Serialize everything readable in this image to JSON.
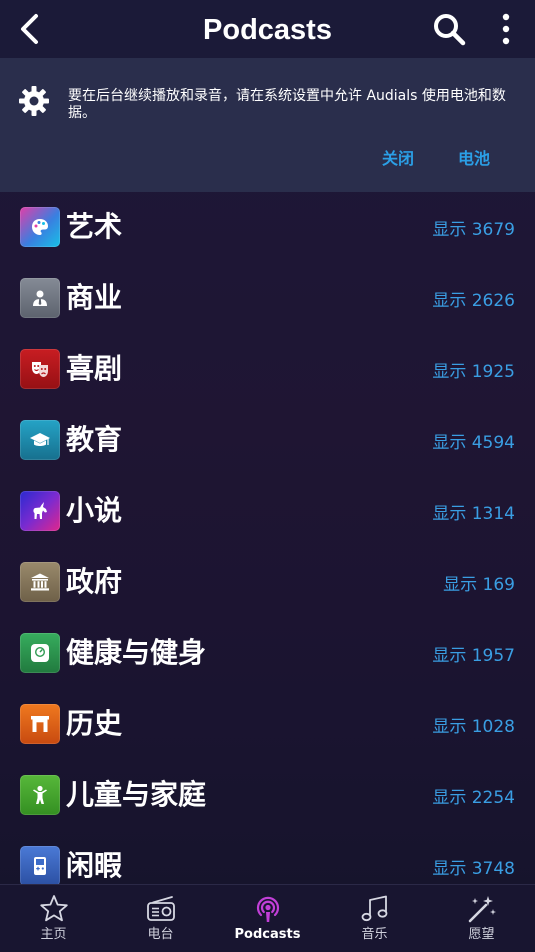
{
  "header": {
    "title": "Podcasts"
  },
  "banner": {
    "message": "要在后台继续播放和录音，请在系统设置中允许 Audials 使用电池和数据。",
    "close_label": "关闭",
    "battery_label": "电池"
  },
  "categories": [
    {
      "label": "艺术",
      "count": "显示 3679",
      "icon": "palette-icon",
      "color": "#3a7fe0"
    },
    {
      "label": "商业",
      "count": "显示 2626",
      "icon": "businessman-icon",
      "color": "#6e7480"
    },
    {
      "label": "喜剧",
      "count": "显示 1925",
      "icon": "theater-masks-icon",
      "color": "#b5161b"
    },
    {
      "label": "教育",
      "count": "显示 4594",
      "icon": "graduation-cap-icon",
      "color": "#1f8fb0"
    },
    {
      "label": "小说",
      "count": "显示 1314",
      "icon": "unicorn-icon",
      "color": "#6a2cc9"
    },
    {
      "label": "政府",
      "count": "显示 169",
      "icon": "government-building-icon",
      "color": "#8a7a5e"
    },
    {
      "label": "健康与健身",
      "count": "显示 1957",
      "icon": "scale-icon",
      "color": "#2f9a52"
    },
    {
      "label": "历史",
      "count": "显示 1028",
      "icon": "arch-icon",
      "color": "#e0641a"
    },
    {
      "label": "儿童与家庭",
      "count": "显示 2254",
      "icon": "child-icon",
      "color": "#4aa82e"
    },
    {
      "label": "闲暇",
      "count": "显示 3748",
      "icon": "gameboy-icon",
      "color": "#3b6bc8"
    }
  ],
  "nav": [
    {
      "label": "主页",
      "icon": "star-icon"
    },
    {
      "label": "电台",
      "icon": "radio-icon"
    },
    {
      "label": "Podcasts",
      "icon": "podcast-icon",
      "active": true,
      "color": "#c23fd8"
    },
    {
      "label": "音乐",
      "icon": "music-note-icon"
    },
    {
      "label": "愿望",
      "icon": "magic-wand-icon"
    }
  ]
}
